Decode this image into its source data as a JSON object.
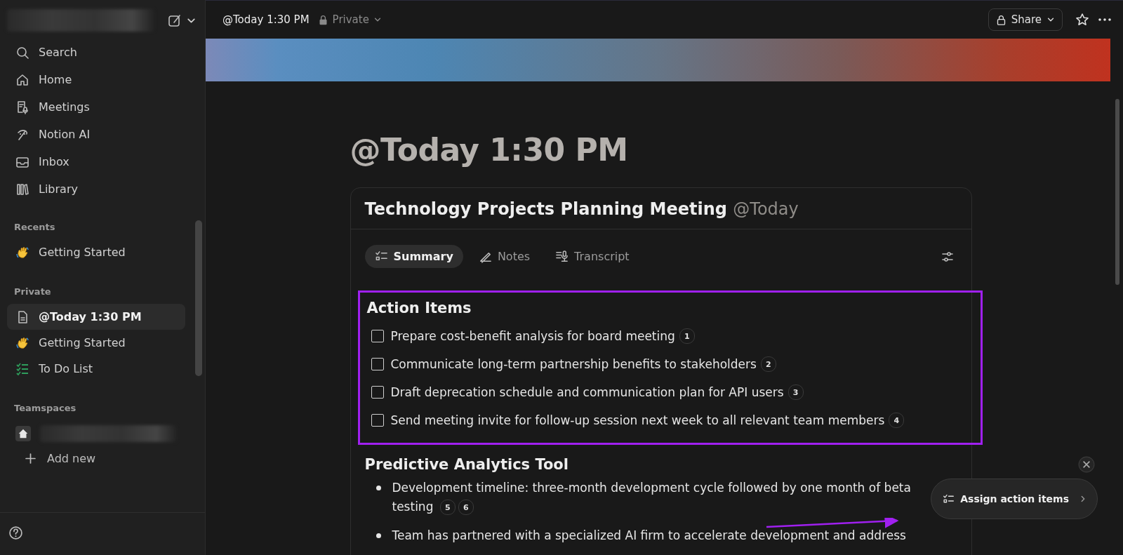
{
  "sidebar": {
    "workspace": {
      "kind": "redacted"
    },
    "nav": [
      {
        "label": "Search",
        "kind": "search",
        "selected": false
      },
      {
        "label": "Home",
        "kind": "home",
        "selected": false
      },
      {
        "label": "Meetings",
        "kind": "meetings",
        "selected": false
      },
      {
        "label": "Notion AI",
        "kind": "ai",
        "selected": false
      },
      {
        "label": "Inbox",
        "kind": "inbox",
        "selected": false
      },
      {
        "label": "Library",
        "kind": "library",
        "selected": false
      }
    ],
    "sections": [
      {
        "title": "Recents",
        "items": [
          {
            "label": "Getting Started",
            "kind": "hand",
            "selected": false
          }
        ]
      },
      {
        "title": "Private",
        "items": [
          {
            "label": "@Today 1:30 PM",
            "kind": "page",
            "selected": true
          },
          {
            "label": "Getting Started",
            "kind": "hand",
            "selected": false
          },
          {
            "label": "To Do List",
            "kind": "checklist",
            "selected": false
          }
        ]
      },
      {
        "title": "Teamspaces",
        "items": [
          {
            "kind": "redacted",
            "selected": false
          }
        ]
      }
    ],
    "add_new": "Add new"
  },
  "topbar": {
    "breadcrumb": "@Today 1:30 PM",
    "privacy": "Private",
    "share": "Share"
  },
  "page": {
    "title": "@Today 1:30 PM",
    "meeting": {
      "title": "Technology Projects Planning Meeting",
      "date": "@Today",
      "tabs": [
        {
          "label": "Summary",
          "kind": "summary",
          "selected": true
        },
        {
          "label": "Notes",
          "kind": "pen",
          "selected": false
        },
        {
          "label": "Transcript",
          "kind": "transcript",
          "selected": false
        }
      ],
      "action_items": {
        "heading": "Action Items",
        "highlighted": true,
        "items": [
          {
            "text": "Prepare cost-benefit analysis for board meeting",
            "checked": false,
            "citations": [
              "1"
            ]
          },
          {
            "text": "Communicate long-term partnership benefits to stakeholders",
            "checked": false,
            "citations": [
              "2"
            ]
          },
          {
            "text": "Draft deprecation schedule and communication plan for API users",
            "checked": false,
            "citations": [
              "3"
            ]
          },
          {
            "text": "Send meeting invite for follow-up session next week to all relevant team members",
            "checked": false,
            "citations": [
              "4"
            ]
          }
        ]
      },
      "sections": [
        {
          "heading": "Predictive Analytics Tool",
          "bullets": [
            {
              "text": "Development timeline: three-month development cycle followed by one month of beta testing",
              "citations": [
                "5",
                "6"
              ]
            },
            {
              "text": "Team has partnered with a specialized AI firm to accelerate development and address"
            }
          ]
        }
      ]
    }
  },
  "popup": {
    "label": "Assign action items"
  }
}
